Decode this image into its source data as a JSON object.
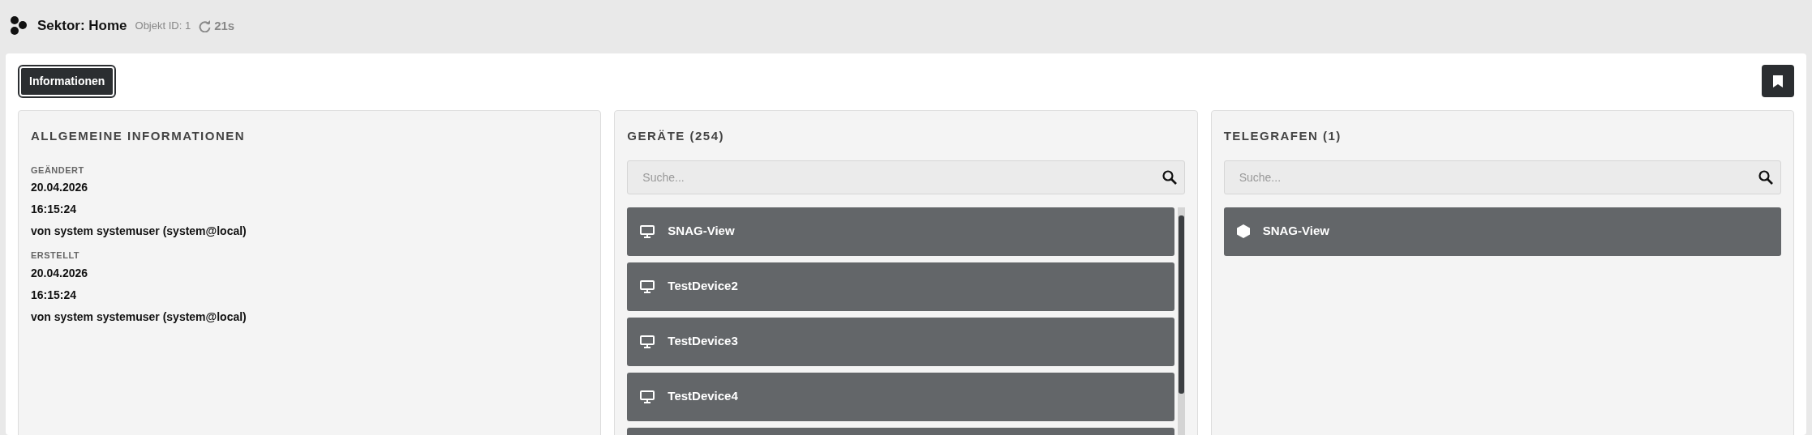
{
  "header": {
    "title": "Sektor: Home",
    "object_id": "Objekt ID: 1",
    "refresh": "21s"
  },
  "tabs": [
    {
      "label": "Informationen",
      "selected": true
    }
  ],
  "panels": [
    {
      "kind": "info",
      "title": "ALLGEMEINE INFORMATIONEN",
      "sections": [
        {
          "label": "GEÄNDERT",
          "lines": [
            "20.04.2026",
            "16:15:24",
            "von system systemuser (system@local)"
          ]
        },
        {
          "label": "ERSTELLT",
          "lines": [
            "20.04.2026",
            "16:15:24",
            "von system systemuser (system@local)"
          ]
        }
      ]
    },
    {
      "kind": "list",
      "title": "GERÄTE (254)",
      "search": {
        "placeholder": "Suche..."
      },
      "items": [
        {
          "kind": "device",
          "name": "SNAG-View"
        },
        {
          "kind": "device",
          "name": "TestDevice2"
        },
        {
          "kind": "device",
          "name": "TestDevice3"
        },
        {
          "kind": "device",
          "name": "TestDevice4"
        },
        {
          "kind": "device"
        }
      ]
    },
    {
      "kind": "list",
      "title": "TELEGRAFEN (1)",
      "search": {
        "placeholder": "Suche..."
      },
      "items": [
        {
          "kind": "telegraph",
          "name": "SNAG-View"
        }
      ]
    }
  ]
}
